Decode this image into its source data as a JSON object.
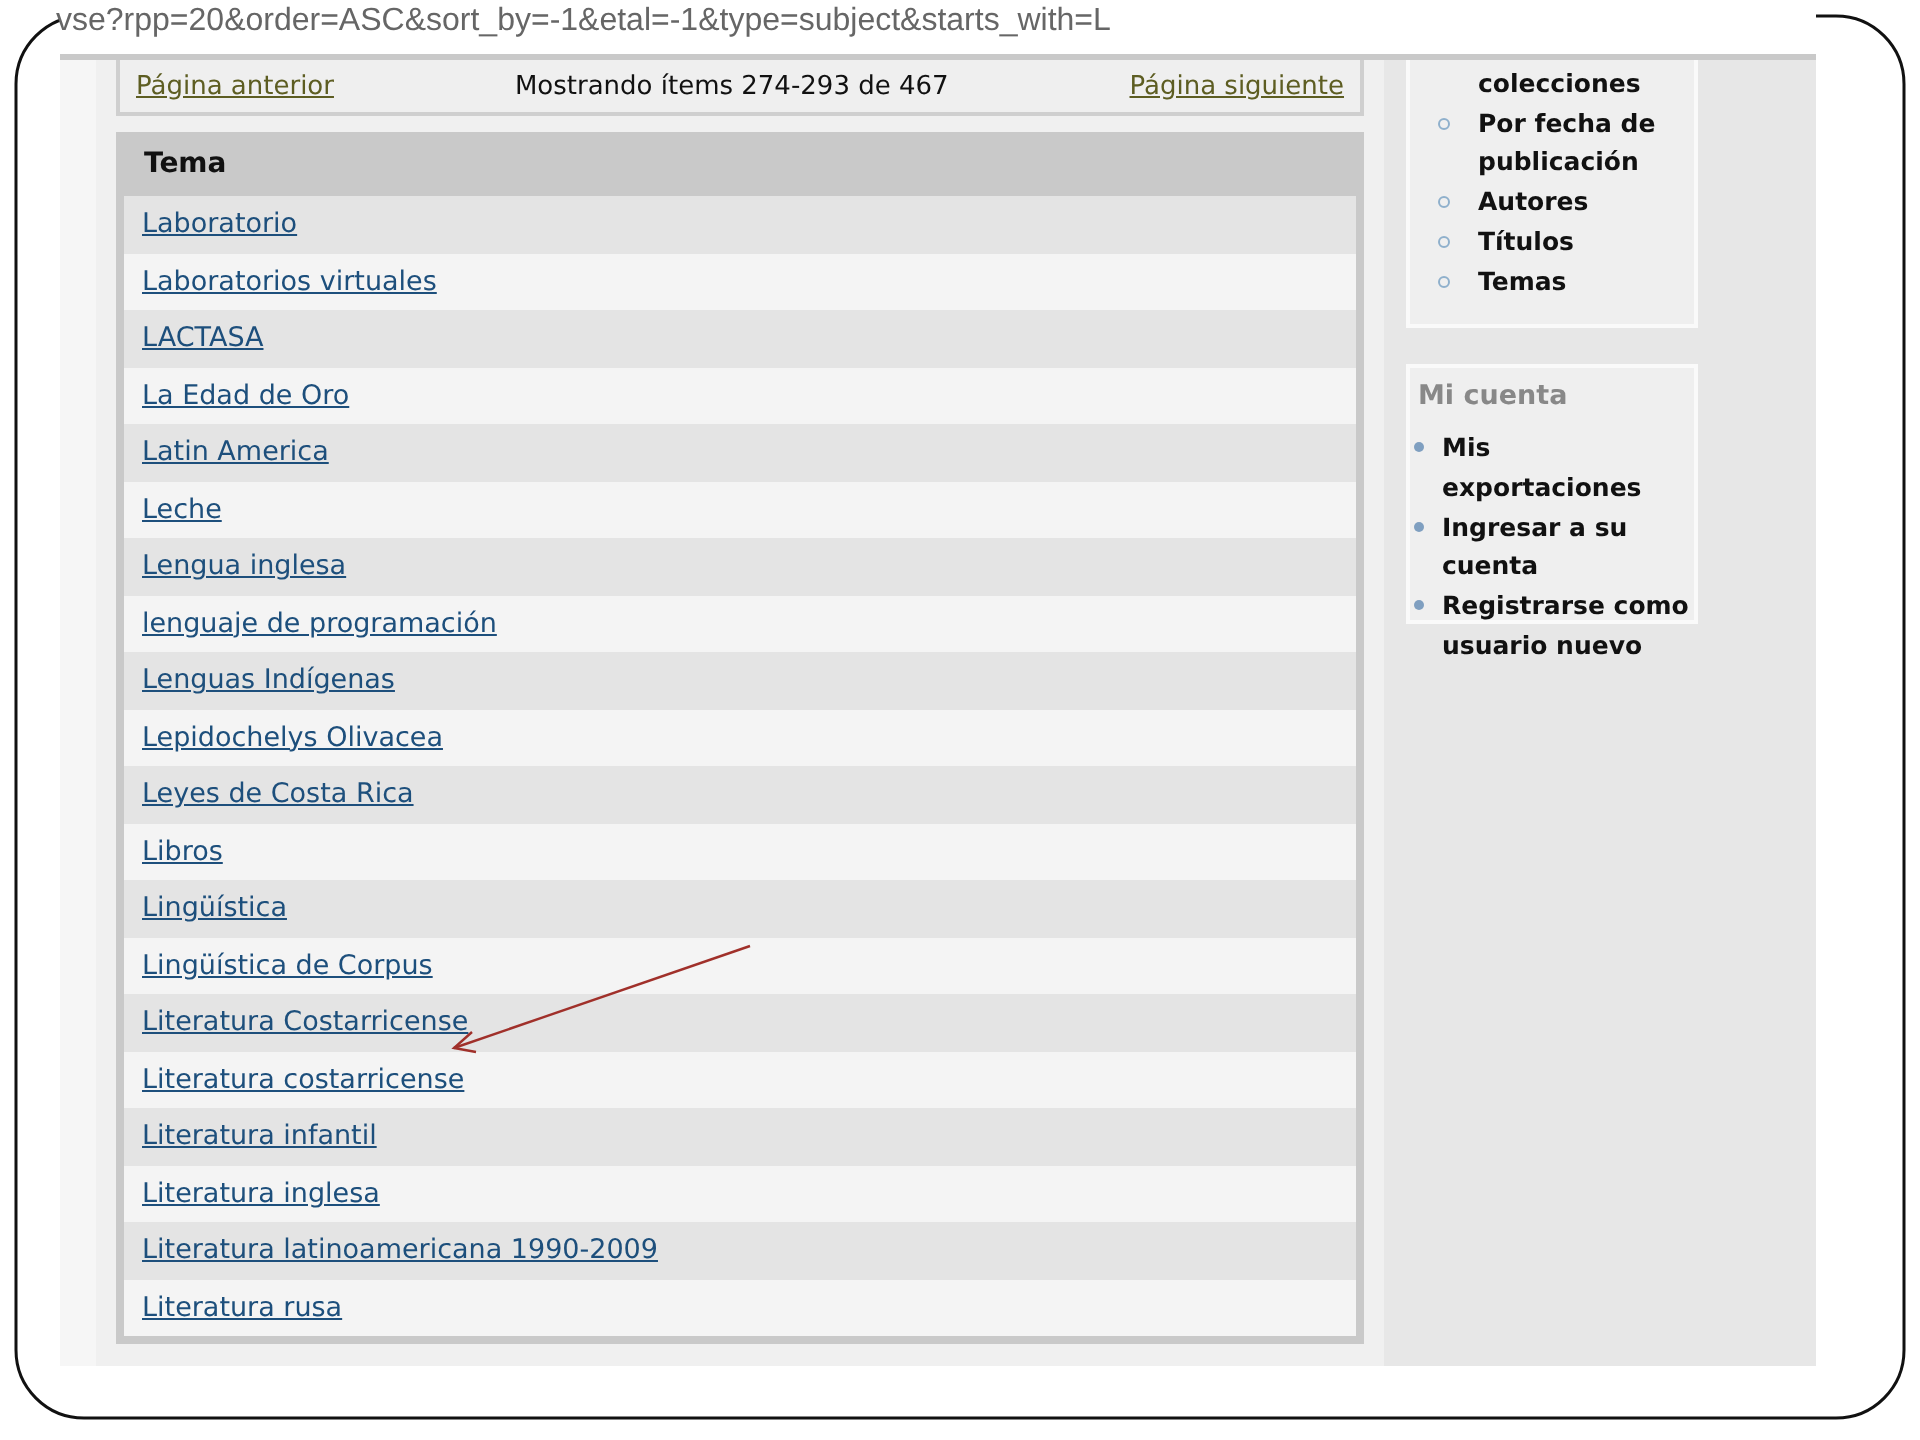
{
  "address_bar": {
    "url": "vse?rpp=20&order=ASC&sort_by=-1&etal=-1&type=subject&starts_with=L"
  },
  "pager": {
    "previous": "Página anterior",
    "status": "Mostrando ítems 274-293 de 467",
    "next": "Página siguiente"
  },
  "table": {
    "columns": [
      "Tema"
    ],
    "rows": [
      "Laboratorio",
      "Laboratorios virtuales",
      "LACTASA",
      "La Edad de Oro",
      "Latin America",
      "Leche",
      "Lengua inglesa",
      "lenguaje de programación",
      "Lenguas Indígenas",
      "Lepidochelys Olivacea",
      "Leyes de Costa Rica",
      "Libros",
      "Lingüística",
      "Lingüística de Corpus",
      "Literatura Costarricense",
      "Literatura costarricense",
      "Literatura infantil",
      "Literatura inglesa",
      "Literatura latinoamericana 1990-2009",
      "Literatura rusa"
    ]
  },
  "sidebar": {
    "browse": {
      "items": [
        {
          "label": "colecciones",
          "kind": "continuation"
        },
        {
          "label": "Por fecha de publicación",
          "kind": "item"
        },
        {
          "label": "Autores",
          "kind": "item"
        },
        {
          "label": "Títulos",
          "kind": "item"
        },
        {
          "label": "Temas",
          "kind": "item"
        }
      ]
    },
    "account": {
      "title": "Mi cuenta",
      "items": [
        "Mis exportaciones",
        "Ingresar a su cuenta",
        "Registrarse como usuario nuevo"
      ]
    }
  }
}
